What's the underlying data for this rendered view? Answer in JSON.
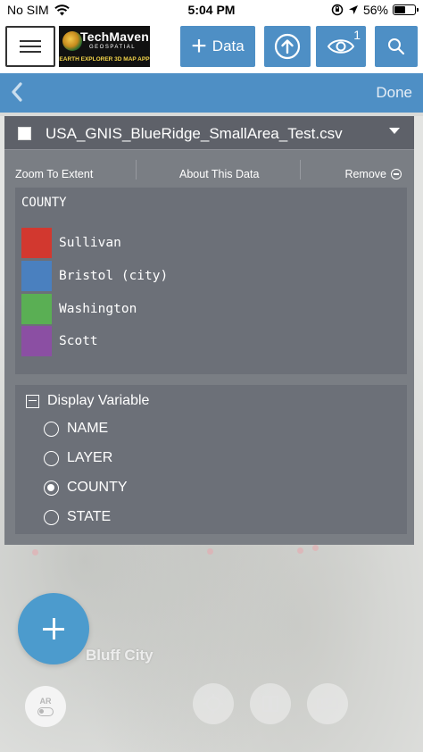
{
  "status_bar": {
    "carrier": "No SIM",
    "time": "5:04 PM",
    "battery_percent": "56%",
    "battery_level": 0.56,
    "icons": [
      "wifi-icon",
      "orientation-lock-icon",
      "location-arrow-icon",
      "battery-icon"
    ]
  },
  "toolbar": {
    "menu_icon": "hamburger-menu-icon",
    "logo": {
      "title": "TechMaven",
      "subtitle": "GEOSPATIAL",
      "tagline": "EARTH EXPLORER 3D MAP APP"
    },
    "data_label": "Data",
    "upload_icon": "upload-circle-icon",
    "eye_icon": "eye-icon",
    "visible_layers_count": "1",
    "search_icon": "search-icon"
  },
  "nav": {
    "back_icon": "chevron-left-icon",
    "done_label": "Done"
  },
  "panel": {
    "file_name": "USA_GNIS_BlueRidge_SmallArea_Test.csv",
    "actions": {
      "zoom_label": "Zoom To Extent",
      "about_label": "About This Data",
      "remove_label": "Remove"
    },
    "legend": {
      "title": "COUNTY",
      "items": [
        {
          "label": "Sullivan",
          "color": "#d2382f"
        },
        {
          "label": "Bristol (city)",
          "color": "#4a80bf"
        },
        {
          "label": "Washington",
          "color": "#5aaf54"
        },
        {
          "label": "Scott",
          "color": "#8b4fa3"
        }
      ]
    },
    "display_variable": {
      "title": "Display Variable",
      "options": [
        "NAME",
        "LAYER",
        "COUNTY",
        "STATE"
      ],
      "selected": "COUNTY"
    }
  },
  "map": {
    "place_label": "Bluff City"
  },
  "controls": {
    "add_icon": "plus-icon",
    "ar_label": "AR"
  }
}
